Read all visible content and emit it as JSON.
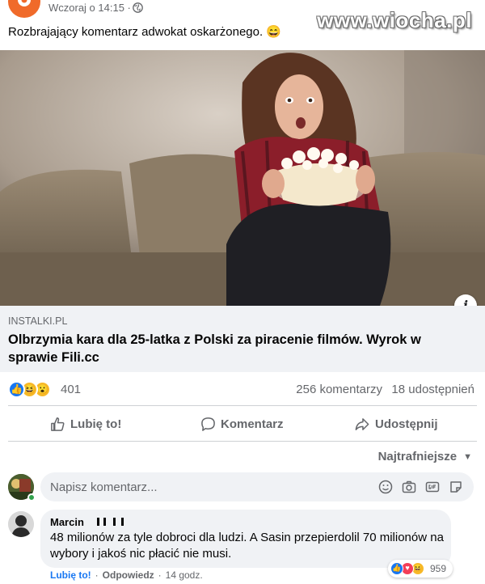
{
  "post": {
    "time": "Wczoraj o 14:15 ·",
    "audience_icon": "globe-icon",
    "text": "Rozbrajający komentarz adwokat oskarżonego. 😄",
    "watermark": "www.wiocha.pl"
  },
  "link_preview": {
    "domain": "INSTALKI.PL",
    "title": "Olbrzymia kara dla 25-latka z Polski za piracenie filmów. Wyrok w sprawie Fili.cc",
    "info_label": "i"
  },
  "stats": {
    "reaction_icons": [
      "like-icon",
      "haha-icon",
      "wow-icon"
    ],
    "reactions": "401",
    "comments": "256 komentarzy",
    "shares": "18 udostępnień"
  },
  "actions": {
    "like": "Lubię to!",
    "comment": "Komentarz",
    "share": "Udostępnij"
  },
  "sort": {
    "label": "Najtrafniejsze"
  },
  "comment_input": {
    "placeholder": "Napisz komentarz..."
  },
  "top_comment": {
    "author": "Marcin",
    "text": "48 milionów za tyle dobroci dla ludzi. A Sasin przepierdolil 70 milionów na wybory i jakoś nic płacić nie musi.",
    "reactions": "959",
    "like_label": "Lubię to!",
    "reply_label": "Odpowiedz",
    "separator": "·",
    "time": "14 godz."
  },
  "colors": {
    "accent": "#1877f2",
    "text_secondary": "#65676b",
    "link_bg": "#f0f2f5",
    "page_avatar": "#f06a2a"
  }
}
